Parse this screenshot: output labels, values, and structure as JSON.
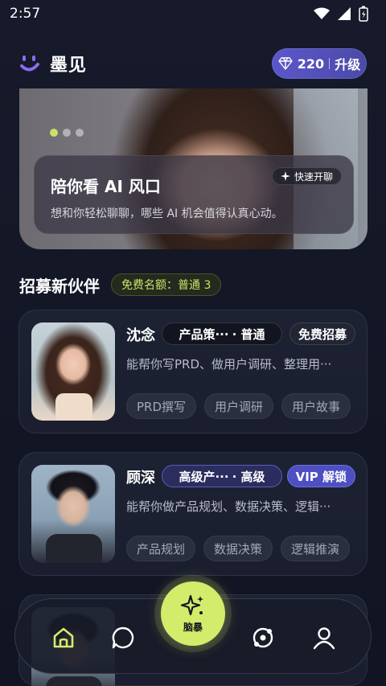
{
  "status_bar": {
    "time": "2:57"
  },
  "header": {
    "app_title": "墨见",
    "gems": "220",
    "upgrade_label": "升级"
  },
  "banner": {
    "title": "陪你看 AI 风口",
    "description": "想和你轻松聊聊，哪些 AI 机会值得认真心动。",
    "quick_chat_label": "快速开聊"
  },
  "section": {
    "title": "招募新伙伴",
    "quota": "免费名额：普通 3"
  },
  "cards": [
    {
      "name": "沈念",
      "role": "产品策···",
      "tier": "· 普通",
      "action": "免费招募",
      "description": "能帮你写PRD、做用户调研、整理用···",
      "tags": [
        "PRD撰写",
        "用户调研",
        "用户故事"
      ]
    },
    {
      "name": "顾深",
      "role": "高级产···",
      "tier": "· 高级",
      "action": "VIP 解锁",
      "description": "能帮你做产品规划、数据决策、逻辑···",
      "tags": [
        "产品规划",
        "数据决策",
        "逻辑推演"
      ]
    }
  ],
  "nav": {
    "center_label": "脑暴"
  },
  "colors": {
    "accent_lime": "#d3ec6b",
    "accent_purple": "#5b57c9"
  }
}
